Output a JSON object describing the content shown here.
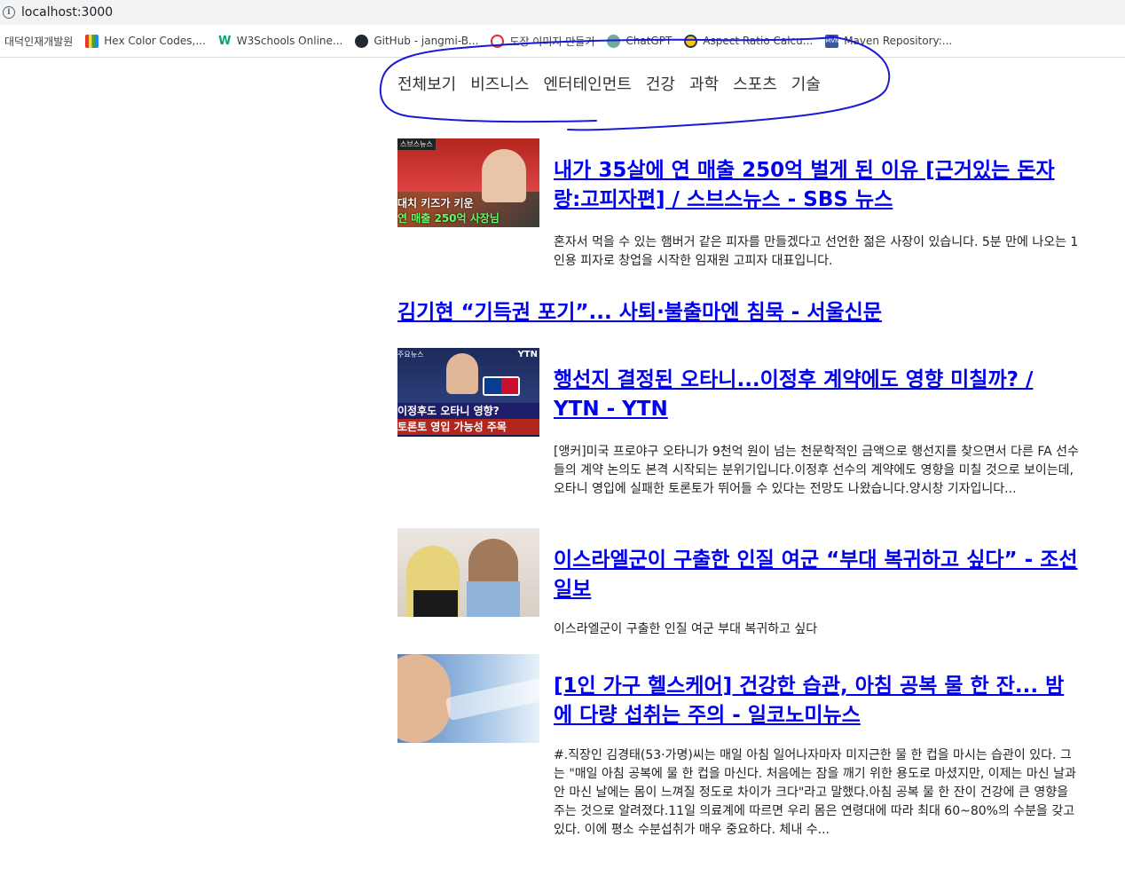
{
  "browser": {
    "url": "localhost:3000",
    "bookmarks": [
      {
        "label": "대덕인재개발원",
        "icon": "none"
      },
      {
        "label": "Hex Color Codes,...",
        "icon": "color-bars-icon"
      },
      {
        "label": "W3Schools Online...",
        "icon": "w3schools-icon"
      },
      {
        "label": "GitHub - jangmi-B...",
        "icon": "github-icon"
      },
      {
        "label": "도장 이미지 만들기",
        "icon": "stamp-icon"
      },
      {
        "label": "ChatGPT",
        "icon": "chatgpt-icon"
      },
      {
        "label": "Aspect Ratio Calcu...",
        "icon": "aspect-ratio-icon"
      },
      {
        "label": "Maven Repository:...",
        "icon": "maven-icon"
      }
    ]
  },
  "nav": {
    "categories": [
      "전체보기",
      "비즈니스",
      "엔터테인먼트",
      "건강",
      "과학",
      "스포츠",
      "기술"
    ]
  },
  "articles": [
    {
      "title": "내가 35살에 연 매출 250억 벌게 된 이유 [근거있는 돈자랑:고피자편] / 스브스뉴스 - SBS 뉴스",
      "description": "혼자서 먹을 수 있는 햄버거 같은 피자를 만들겠다고 선언한 젊은 사장이 있습니다. 5분 만에 나오는 1인용 피자로 창업을 시작한 임재원 고피자 대표입니다.",
      "thumbnail_caption_1": "대치 키즈가 키운",
      "thumbnail_caption_2": "연 매출 250억 사장님",
      "thumbnail_tag": "스브스뉴스"
    },
    {
      "title": "김기현 “기득권 포기”... 사퇴·불출마엔 침묵 - 서울신문"
    },
    {
      "title": "행선지 결정된 오타니...이정후 계약에도 영향 미칠까? / YTN - YTN",
      "description": "[앵커]미국 프로야구 오타니가 9천억 원이 넘는 천문학적인 금액으로 행선지를 찾으면서 다른 FA 선수들의 계약 논의도 본격 시작되는 분위기입니다.이정후 선수의 계약에도 영향을 미칠 것으로 보이는데, 오타니 영입에 실패한 토론토가 뛰어들 수 있다는 전망도 나왔습니다.양시창 기자입니다...",
      "thumbnail_caption_1": "이정후도 오타니 영향?",
      "thumbnail_caption_2": "토론토 영입 가능성 주목",
      "thumbnail_tag": "주요뉴스",
      "thumbnail_logo": "YTN"
    },
    {
      "title": "이스라엘군이 구출한 인질 여군 “부대 복귀하고 싶다” - 조선일보",
      "description": "이스라엘군이 구출한 인질 여군 부대 복귀하고 싶다"
    },
    {
      "title": "[1인 가구 헬스케어] 건강한 습관, 아침 공복 물 한 잔... 밤에 다량 섭취는 주의 - 일코노미뉴스",
      "description": "#.직장인 김경태(53·가명)씨는 매일 아침 일어나자마자 미지근한 물 한 컵을 마시는 습관이 있다. 그는 \"매일 아침 공복에 물 한 컵을 마신다. 처음에는 잠을 깨기 위한 용도로 마셨지만, 이제는 마신 날과 안 마신 날에는 몸이 느껴질 정도로 차이가 크다\"라고 말했다.아침 공복 물 한 잔이 건강에 큰 영향을 주는 것으로 알려졌다.11일 의료계에 따르면 우리 몸은 연령대에 따라 최대 60~80%의 수분을 갖고 있다. 이에 평소 수분섭취가 매우 중요하다. 체내 수..."
    }
  ],
  "colors": {
    "link": "#0000ee",
    "scribble": "#1a1ad8"
  }
}
